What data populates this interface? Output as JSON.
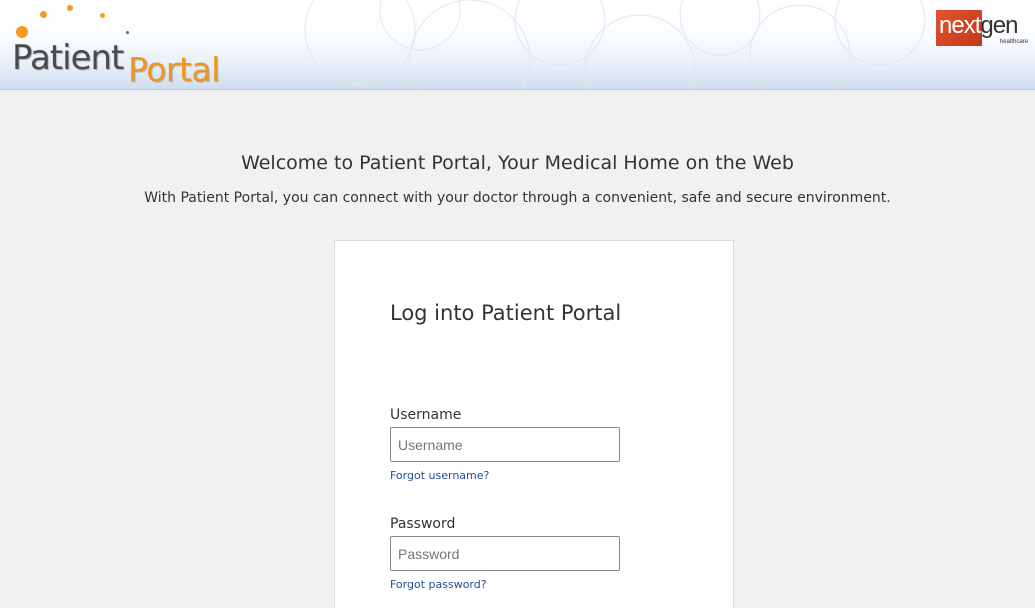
{
  "header": {
    "logo_part1": "Patient",
    "logo_part2": "Portal",
    "brand_name_light": "next",
    "brand_name_dark": "gen",
    "brand_sub": "healthcare"
  },
  "welcome": {
    "title": "Welcome to Patient Portal, Your Medical Home on the Web",
    "subtitle": "With Patient Portal, you can connect with your doctor through a convenient, safe and secure environment."
  },
  "login": {
    "title": "Log into Patient Portal",
    "username_label": "Username",
    "username_placeholder": "Username",
    "username_value": "",
    "forgot_username": "Forgot username?",
    "password_label": "Password",
    "password_placeholder": "Password",
    "password_value": "",
    "forgot_password": "Forgot password?"
  },
  "colors": {
    "accent_orange": "#f0961e",
    "link_blue": "#1f4e9a",
    "brand_red": "#c2381b"
  }
}
